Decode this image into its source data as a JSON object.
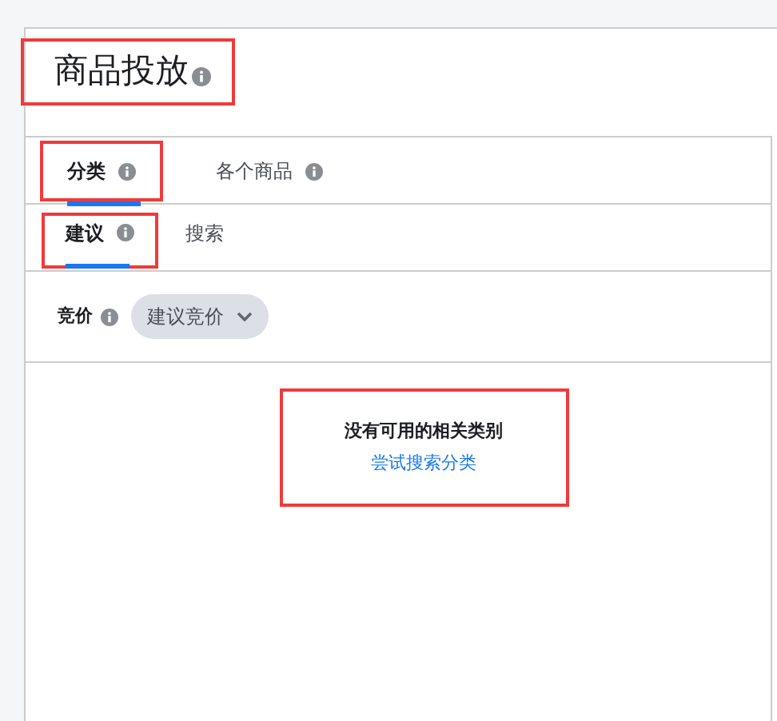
{
  "panel": {
    "title": "商品投放",
    "title_highlighted": true
  },
  "tabs": [
    {
      "label": "分类",
      "selected": true,
      "highlighted": true
    },
    {
      "label": "各个商品",
      "selected": false,
      "highlighted": false
    }
  ],
  "subtabs": [
    {
      "label": "建议",
      "selected": true,
      "highlighted": true,
      "info": true
    },
    {
      "label": "搜索",
      "selected": false,
      "highlighted": false,
      "info": false
    }
  ],
  "bid": {
    "label": "竞价",
    "value": "建议竞价"
  },
  "empty_state": {
    "message": "没有可用的相关类别",
    "link": "尝试搜索分类",
    "highlighted": true
  }
}
